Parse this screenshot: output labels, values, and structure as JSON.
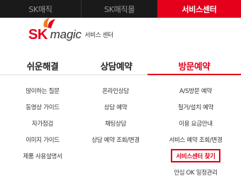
{
  "top_tabs": [
    "SK매직",
    "SK매직몰",
    "서비스센터"
  ],
  "logo": {
    "brand": "SK",
    "product": "magic",
    "subtitle": "서비스 센터"
  },
  "categories": [
    "쉬운해결",
    "상담예약",
    "방문예약"
  ],
  "columns": {
    "easy_fix": [
      "많이하는 질문",
      "동영상 가이드",
      "자가점검",
      "이미지 가이드",
      "제품 사용설명서"
    ],
    "consult": [
      "온라인상담",
      "상담 예약",
      "채팅상담",
      "상담 예약 조회/변경"
    ],
    "visit": [
      "A/S방문 예약",
      "철거/설치 예약",
      "이용 요금안내",
      "서비스 예약 조회/변경",
      "서비스센터 찾기",
      "안심 OK 일정관리"
    ]
  },
  "colors": {
    "accent": "#e4001b",
    "topbar_bg": "#1a1a1a"
  },
  "icons": {
    "logo_mark": "sk-butterfly-logo"
  }
}
